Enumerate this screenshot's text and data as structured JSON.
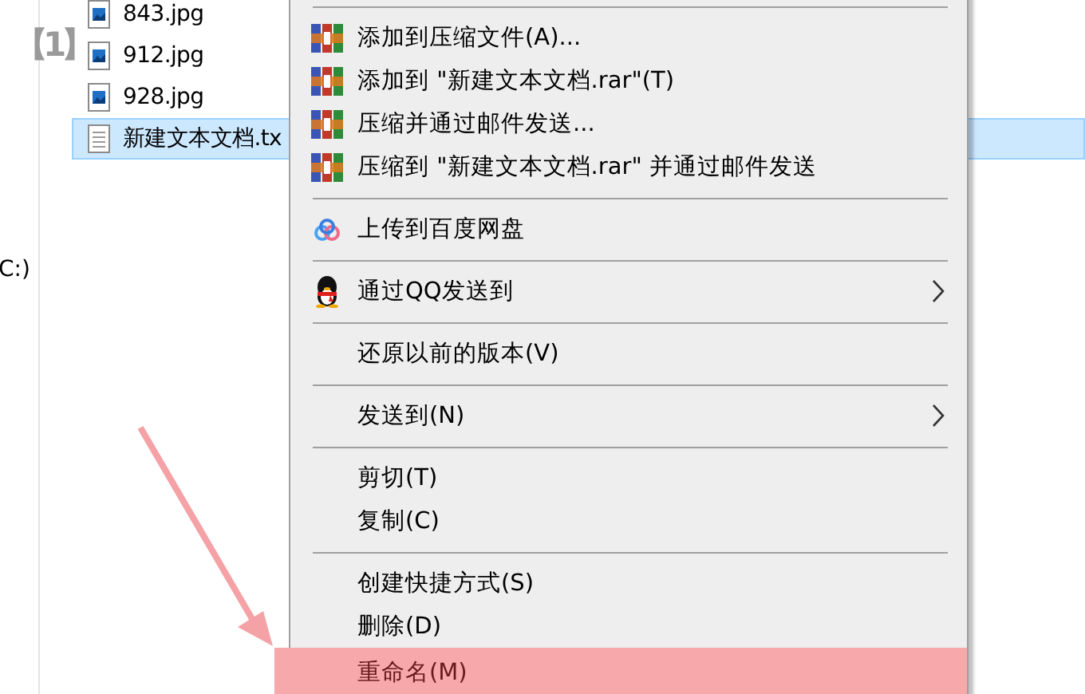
{
  "annotation_label": "【1】",
  "nav_pane": {
    "drive_label": "C:)"
  },
  "files": [
    {
      "name": "843.jpg",
      "kind": "image",
      "selected": false
    },
    {
      "name": "912.jpg",
      "kind": "image",
      "selected": false
    },
    {
      "name": "928.jpg",
      "kind": "image",
      "selected": false
    },
    {
      "name": "新建文本文档.tx",
      "kind": "text",
      "selected": true
    }
  ],
  "context_menu": {
    "groups": [
      [
        {
          "label": "添加到压缩文件(A)...",
          "kind": "archive",
          "submenu": false,
          "selected": false
        },
        {
          "label": "添加到 \"新建文本文档.rar\"(T)",
          "kind": "archive",
          "submenu": false,
          "selected": false
        },
        {
          "label": "压缩并通过邮件发送...",
          "kind": "archive",
          "submenu": false,
          "selected": false
        },
        {
          "label": "压缩到 \"新建文本文档.rar\" 并通过邮件发送",
          "kind": "archive",
          "submenu": false,
          "selected": false
        }
      ],
      [
        {
          "label": "上传到百度网盘",
          "kind": "cloud",
          "submenu": false,
          "selected": false
        }
      ],
      [
        {
          "label": "通过QQ发送到",
          "kind": "chat",
          "submenu": true,
          "selected": false
        }
      ],
      [
        {
          "label": "还原以前的版本(V)",
          "kind": "plain",
          "submenu": false,
          "selected": false
        }
      ],
      [
        {
          "label": "发送到(N)",
          "kind": "plain",
          "submenu": true,
          "selected": false
        }
      ],
      [
        {
          "label": "剪切(T)",
          "kind": "plain",
          "submenu": false,
          "selected": false
        },
        {
          "label": "复制(C)",
          "kind": "plain",
          "submenu": false,
          "selected": false
        }
      ],
      [
        {
          "label": "创建快捷方式(S)",
          "kind": "plain",
          "submenu": false,
          "selected": false
        },
        {
          "label": "删除(D)",
          "kind": "plain",
          "submenu": false,
          "selected": false
        },
        {
          "label": "重命名(M)",
          "kind": "plain",
          "submenu": false,
          "selected": true
        }
      ]
    ]
  }
}
